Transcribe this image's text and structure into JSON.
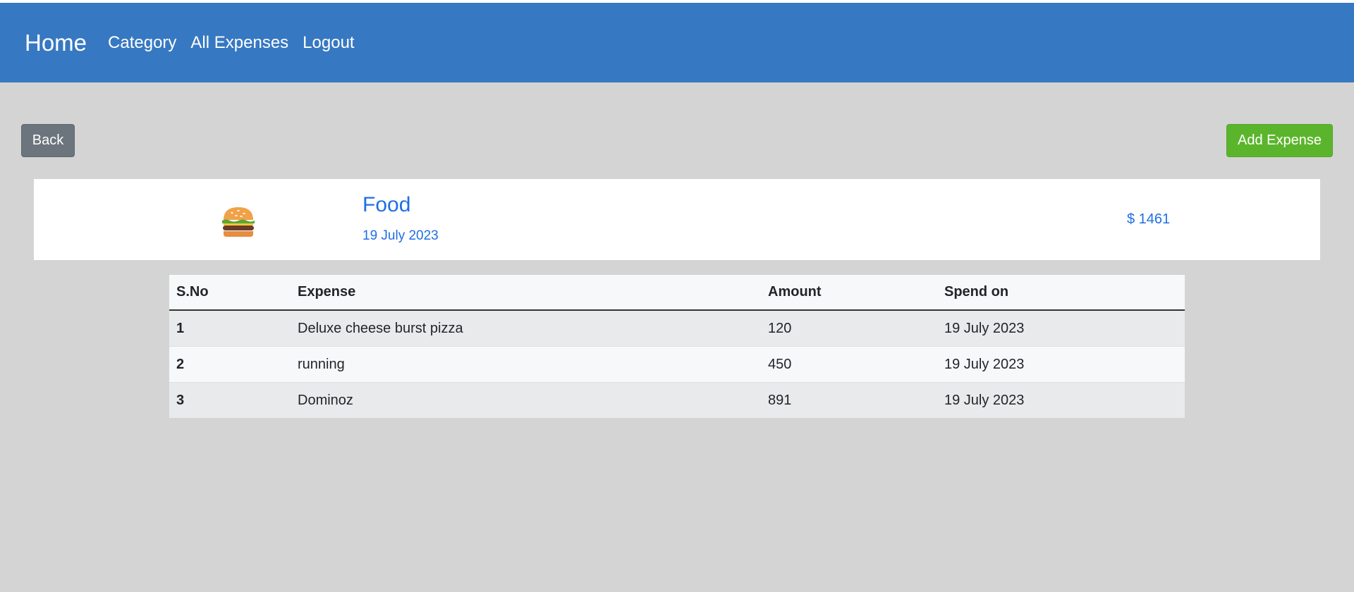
{
  "navbar": {
    "brand": "Home",
    "links": [
      "Category",
      "All Expenses",
      "Logout"
    ]
  },
  "actions": {
    "back_label": "Back",
    "add_label": "Add Expense"
  },
  "category_card": {
    "icon": "burger-icon",
    "title": "Food",
    "date": "19 July 2023",
    "total": "$ 1461"
  },
  "table": {
    "headers": [
      "S.No",
      "Expense",
      "Amount",
      "Spend on"
    ],
    "rows": [
      {
        "sno": "1",
        "expense": "Deluxe cheese burst pizza",
        "amount": "120",
        "spend_on": "19 July 2023"
      },
      {
        "sno": "2",
        "expense": "running",
        "amount": "450",
        "spend_on": "19 July 2023"
      },
      {
        "sno": "3",
        "expense": "Dominoz",
        "amount": "891",
        "spend_on": "19 July 2023"
      }
    ]
  },
  "colors": {
    "navbar": "#3778c2",
    "back_button": "#6c757d",
    "add_button": "#5bb52c",
    "accent_text": "#1f6fe5",
    "page_background": "#d4d4d4"
  }
}
